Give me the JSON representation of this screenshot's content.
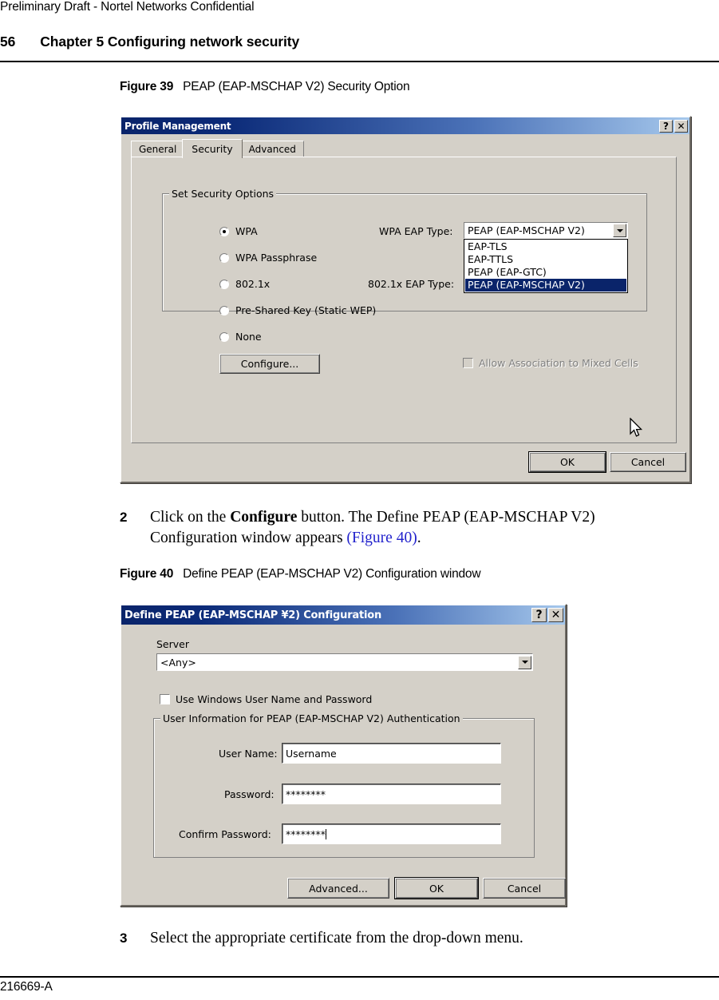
{
  "page": {
    "draft_notice": "Preliminary Draft - Nortel Networks Confidential",
    "page_number": "56",
    "running_head": "Chapter 5 Configuring network security",
    "footer_id": "216669-A"
  },
  "figure39": {
    "caption_label": "Figure 39",
    "caption_text": "PEAP (EAP-MSCHAP V2) Security Option",
    "dialog": {
      "title": "Profile Management",
      "help_button": "?",
      "close_button": "✕",
      "tabs": [
        {
          "label": "General",
          "selected": false
        },
        {
          "label": "Security",
          "selected": true
        },
        {
          "label": "Advanced",
          "selected": false
        }
      ],
      "group_title": "Set Security Options",
      "radios": [
        {
          "label": "WPA",
          "checked": true
        },
        {
          "label": "WPA Passphrase",
          "checked": false
        },
        {
          "label": "802.1x",
          "checked": false
        },
        {
          "label": "Pre-Shared Key (Static WEP)",
          "checked": false
        },
        {
          "label": "None",
          "checked": false
        }
      ],
      "wpa_eap_type_label": "WPA EAP Type:",
      "wpa_eap_type_value": "PEAP (EAP-MSCHAP V2)",
      "dot1x_eap_type_label": "802.1x EAP Type:",
      "eap_options": [
        "EAP-TLS",
        "EAP-TTLS",
        "PEAP (EAP-GTC)",
        "PEAP (EAP-MSCHAP V2)"
      ],
      "eap_selected_index": 3,
      "configure_button": "Configure...",
      "mixed_cells_label": "Allow Association to Mixed Cells",
      "mixed_cells_checked": false,
      "mixed_cells_disabled": true,
      "ok_button": "OK",
      "cancel_button": "Cancel"
    }
  },
  "step2": {
    "number": "2",
    "text_before": "Click on the ",
    "bold_word": "Configure",
    "text_middle": " button. The Define PEAP (EAP-MSCHAP V2) Configuration window appears ",
    "link": "(Figure 40)",
    "text_after": "."
  },
  "figure40": {
    "caption_label": "Figure 40",
    "caption_text": "Define PEAP (EAP-MSCHAP V2) Configuration window",
    "dialog": {
      "title": "Define PEAP (EAP-MSCHAP ¥2) Configuration",
      "help_button": "?",
      "close_button": "✕",
      "server_label": "Server",
      "server_value": "<Any>",
      "use_windows_creds_label": "Use Windows User Name and Password",
      "use_windows_creds_checked": false,
      "group_title": "User Information for PEAP (EAP-MSCHAP V2) Authentication",
      "fields": [
        {
          "label": "User Name:",
          "value": "Username",
          "caret": false
        },
        {
          "label": "Password:",
          "value": "********",
          "caret": false
        },
        {
          "label": "Confirm Password:",
          "value": "********",
          "caret": true
        }
      ],
      "advanced_button": "Advanced...",
      "ok_button": "OK",
      "cancel_button": "Cancel"
    }
  },
  "step3": {
    "number": "3",
    "text": "Select the appropriate certificate from the drop-down menu."
  }
}
